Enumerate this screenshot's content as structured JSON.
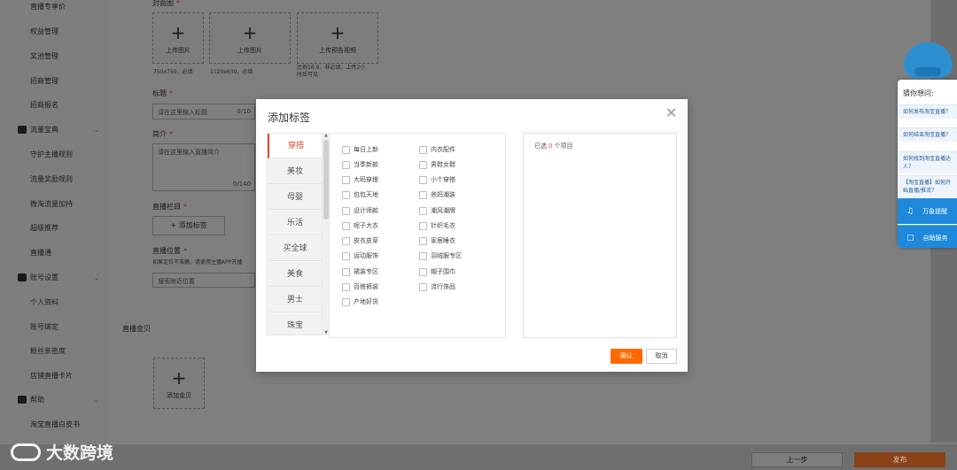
{
  "sidebar": {
    "items": [
      {
        "label": "直播专享价"
      },
      {
        "label": "权益管理"
      },
      {
        "label": "奖池管理"
      },
      {
        "label": "招商管理"
      },
      {
        "label": "招商报名"
      },
      {
        "section": "流量宝典"
      },
      {
        "label": "守护主播规则"
      },
      {
        "label": "流量奖励规则"
      },
      {
        "label": "微淘流量加持"
      },
      {
        "label": "超级推荐"
      },
      {
        "label": "直播通"
      },
      {
        "section": "账号设置"
      },
      {
        "label": "个人资料"
      },
      {
        "label": "账号绑定"
      },
      {
        "label": "粉丝亲密度"
      },
      {
        "label": "店铺直播卡片"
      },
      {
        "section": "帮助"
      },
      {
        "label": "淘宝直播白皮书"
      }
    ]
  },
  "form": {
    "cover_label": "封面图",
    "uploads": [
      {
        "label": "上传图片",
        "hint": "750x750，必填"
      },
      {
        "label": "上传图片",
        "hint": "1120x630，必填"
      },
      {
        "label": "上传预告视频",
        "hint_line1": "比例16:9，非必填，上传2小",
        "hint_line2": "时后可见"
      }
    ],
    "title_label": "标题",
    "title_placeholder": "请在这里输入标题",
    "title_counter": "0/10",
    "intro_label": "简介",
    "intro_placeholder": "请在这里输入直播简介",
    "intro_counter": "0/140",
    "column_label": "直播栏目",
    "add_tag_button": "+ 添加标签",
    "location_label": "直播位置",
    "location_note": "如果定位不准确，请使用主播APP开播",
    "location_placeholder": "搜索附近位置",
    "gold_section": "直播金贝",
    "add_gold_label": "添加金贝"
  },
  "help_widget": {
    "title": "猜你想问:",
    "questions": [
      "如何发布淘宝直播？",
      "如何结束淘宝直播？",
      "如何找到淘宝直播达人？",
      "【淘宝直播】如何开始直播/推流？"
    ],
    "buttons": [
      {
        "label": "万象提醒",
        "icon": "bell-icon"
      },
      {
        "label": "自助服务",
        "icon": "chat-icon"
      }
    ]
  },
  "modal": {
    "title": "添加标签",
    "tabs": [
      "穿搭",
      "美妆",
      "母婴",
      "乐活",
      "买全球",
      "美食",
      "男士",
      "珠宝"
    ],
    "active_tab": "穿搭",
    "categories_col1": [
      "每日上新",
      "当季新款",
      "大码穿搭",
      "包包天地",
      "设计师款",
      "呢子大衣",
      "皮衣皮草",
      "运动服饰",
      "裙装专区",
      "百搭裤装",
      "产地好货"
    ],
    "categories_col2": [
      "内衣配件",
      "男鞋女鞋",
      "小个穿搭",
      "爸妈潮装",
      "潮风潮牌",
      "针织毛衣",
      "家居睡衣",
      "羽绒服专区",
      "帽子围巾",
      "流行饰品"
    ],
    "selected_prefix": "已选",
    "selected_count": "0",
    "selected_suffix": "个项目",
    "confirm_label": "确认",
    "cancel_label": "取消"
  },
  "footer": {
    "prev_label": "上一步",
    "publish_label": "发布",
    "watermark": "大数跨境"
  },
  "colors": {
    "accent": "#ff6a00",
    "active_tab": "#e04a2a",
    "help_blue": "#1e89db"
  }
}
